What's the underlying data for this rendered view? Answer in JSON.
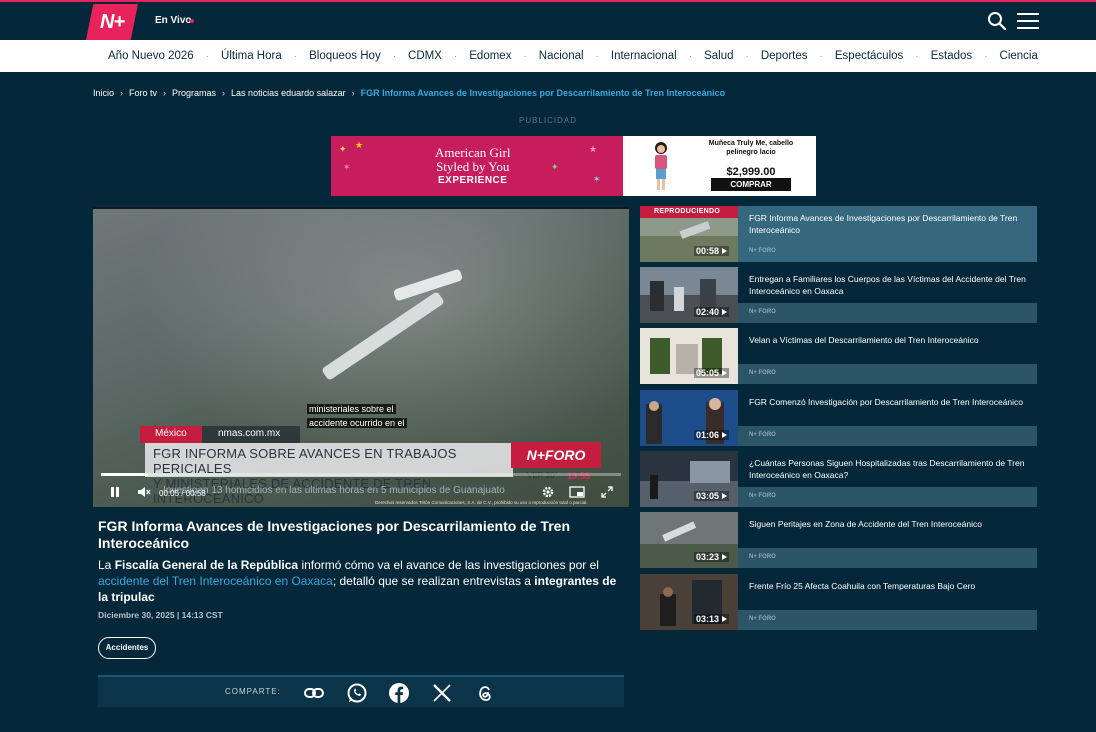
{
  "header": {
    "logo": "N+",
    "live_label": "En Vivo"
  },
  "nav": {
    "items": [
      "Año Nuevo 2026",
      "Última Hora",
      "Bloqueos Hoy",
      "CDMX",
      "Edomex",
      "Nacional",
      "Internacional",
      "Salud",
      "Deportes",
      "Espectáculos",
      "Estados",
      "Ciencia"
    ],
    "separator": "·"
  },
  "breadcrumb": {
    "items": [
      "Inicio",
      "Foro tv",
      "Programas",
      "Las noticias eduardo salazar"
    ],
    "current": "FGR Informa Avances de Investigaciones por Descarrilamiento de Tren Interoceánico",
    "separator": "›"
  },
  "ad": {
    "label": "PUBLICIDAD",
    "brand_line1": "American Girl",
    "brand_line2": "Styled by You",
    "brand_line3": "EXPERIENCE",
    "product": "Muñeca Truly Me, cabello pelinegro lacio",
    "price": "$2,999.00",
    "cta": "COMPRAR"
  },
  "player": {
    "subtitle_line1": "ministeriales sobre el",
    "subtitle_line2": "accidente ocurrido en el",
    "region": "México",
    "site": "nmas.com.mx",
    "headline_line1": "FGR INFORMA SOBRE AVANCES EN TRABAJOS PERICIALES",
    "headline_line2": "Y MINISTERIALES DE ACCIDENTE DE TREN INTEROCEÁNICO",
    "channel_logo": "N+FORO",
    "temp": "VER 20°",
    "clock": "13:55",
    "ticker": "Investigan 13 homicidios en las últimas horas en 5 municipios de Guanajuato",
    "rights": "Derechos reservados Tritón Comunicaciones, S.A. de C.V., prohibido su uso o reproducción total o parcial.",
    "current_time": "00:05",
    "duration": "00:58",
    "time_separator": "/",
    "progress": 0.09
  },
  "article": {
    "title": "FGR Informa Avances de Investigaciones por Descarrilamiento de Tren Interoceánico",
    "lead_1": "La ",
    "lead_bold_1": "Fiscalía General de la República",
    "lead_2": " informó cómo va el avance de las investigaciones por el ",
    "lead_link": "accidente del Tren Interoceánico en Oaxaca",
    "lead_3": "; detalló que se realizan entrevistas a ",
    "lead_bold_2": "integrantes de la tripulac",
    "date": "Diciembre 30, 2025 | 14:13 CST",
    "tag": "Accidentes"
  },
  "share": {
    "label": "COMPARTE:",
    "icons": [
      "link-icon",
      "whatsapp-icon",
      "facebook-icon",
      "x-icon",
      "threads-icon"
    ]
  },
  "playlist": {
    "playing_label": "REPRODUCIENDO",
    "source_label": "N+ FORO",
    "items": [
      {
        "title": "FGR Informa Avances de Investigaciones por Descarrilamiento de Tren Interoceánico",
        "duration": "00:58"
      },
      {
        "title": "Entregan a Familiares los Cuerpos de las Víctimas del Accidente del Tren Interoceánico en Oaxaca",
        "duration": "02:40"
      },
      {
        "title": "Velan a Víctimas del Descarrilamiento del Tren Interoceánico",
        "duration": "05:05"
      },
      {
        "title": "FGR Comenzó Investigación por Descarrilamiento de Tren Interoceánico",
        "duration": "01:06"
      },
      {
        "title": "¿Cuántas Personas Siguen Hospitalizadas tras Descarrilamiento de Tren Interoceánico en Oaxaca?",
        "duration": "03:05"
      },
      {
        "title": "Siguen Peritajes en Zona de Accidente del Tren Interoceánico",
        "duration": "03:23"
      },
      {
        "title": "Frente Frío 25 Afecta Coahuila con Temperaturas Bajo Cero",
        "duration": "03:13"
      }
    ]
  },
  "colors": {
    "brand": "#e8225a",
    "background": "#04273a",
    "accent_link": "#37a9dd"
  }
}
